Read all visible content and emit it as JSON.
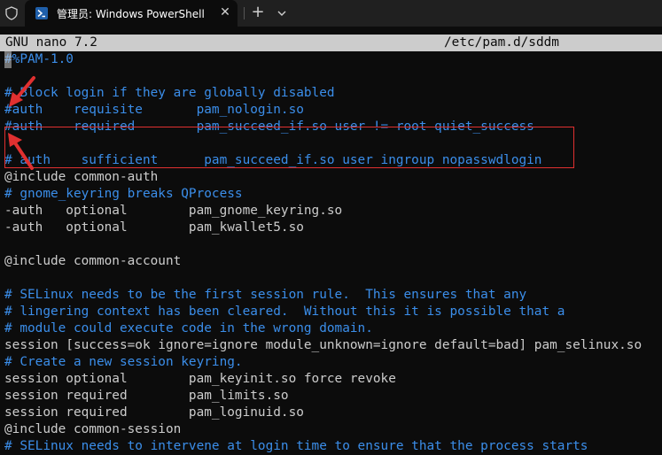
{
  "titlebar": {
    "tab_title": "管理员: Windows PowerShell",
    "close_glyph": "✕",
    "new_tab_glyph": "+"
  },
  "nano": {
    "version": "GNU nano 7.2",
    "file_path": "/etc/pam.d/sddm"
  },
  "lines": [
    {
      "text": "#%PAM-1.0",
      "kind": "comment"
    },
    {
      "text": "",
      "kind": "text"
    },
    {
      "text": "# Block login if they are globally disabled",
      "kind": "comment"
    },
    {
      "text": "#auth    requisite       pam_nologin.so",
      "kind": "comment"
    },
    {
      "text": "#auth    required        pam_succeed_if.so user != root quiet_success",
      "kind": "comment"
    },
    {
      "text": "",
      "kind": "text"
    },
    {
      "text": "# auth    sufficient      pam_succeed_if.so user ingroup nopasswdlogin",
      "kind": "comment"
    },
    {
      "text": "@include common-auth",
      "kind": "text"
    },
    {
      "text": "# gnome_keyring breaks QProcess",
      "kind": "comment"
    },
    {
      "text": "-auth   optional        pam_gnome_keyring.so",
      "kind": "text"
    },
    {
      "text": "-auth   optional        pam_kwallet5.so",
      "kind": "text"
    },
    {
      "text": "",
      "kind": "text"
    },
    {
      "text": "@include common-account",
      "kind": "text"
    },
    {
      "text": "",
      "kind": "text"
    },
    {
      "text": "# SELinux needs to be the first session rule.  This ensures that any",
      "kind": "comment"
    },
    {
      "text": "# lingering context has been cleared.  Without this it is possible that a",
      "kind": "comment"
    },
    {
      "text": "# module could execute code in the wrong domain.",
      "kind": "comment"
    },
    {
      "text": "session [success=ok ignore=ignore module_unknown=ignore default=bad] pam_selinux.so",
      "kind": "text"
    },
    {
      "text": "# Create a new session keyring.",
      "kind": "comment"
    },
    {
      "text": "session optional        pam_keyinit.so force revoke",
      "kind": "text"
    },
    {
      "text": "session required        pam_limits.so",
      "kind": "text"
    },
    {
      "text": "session required        pam_loginuid.so",
      "kind": "text"
    },
    {
      "text": "@include common-session",
      "kind": "text"
    },
    {
      "text": "# SELinux needs to intervene at login time to ensure that the process starts",
      "kind": "comment"
    }
  ],
  "colors": {
    "comment": "#3b8eea",
    "text": "#cccccc",
    "annotation": "#e03030",
    "header_bg": "#cccccc",
    "terminal_bg": "#0c0c0c"
  },
  "icons": {
    "shield": "shield-icon",
    "powershell": "powershell-icon",
    "close": "close-icon",
    "new_tab": "plus-icon",
    "dropdown": "chevron-down-icon"
  }
}
